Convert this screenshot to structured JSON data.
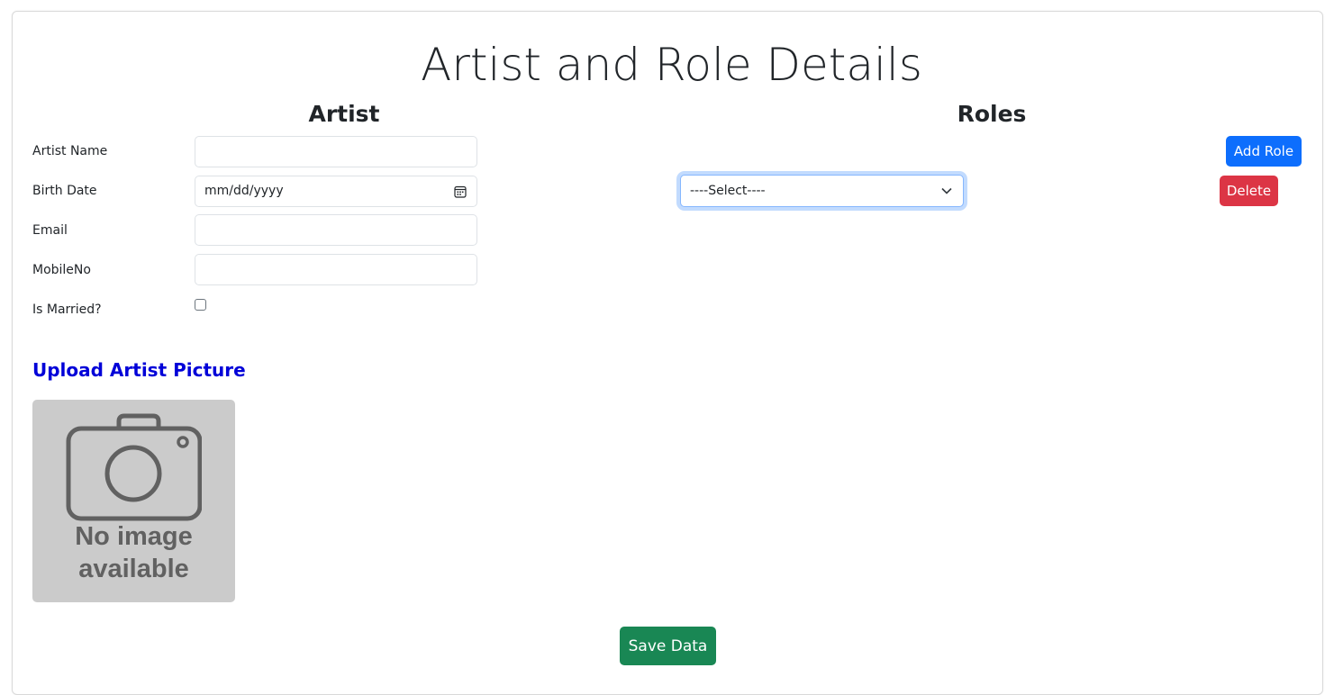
{
  "page": {
    "title": "Artist and Role Details"
  },
  "artist": {
    "heading": "Artist",
    "fields": {
      "name_label": "Artist Name",
      "name_value": "",
      "birth_date_label": "Birth Date",
      "birth_date_placeholder": "mm/dd/yyyy",
      "email_label": "Email",
      "email_value": "",
      "mobile_label": "MobileNo",
      "mobile_value": "",
      "married_label": "Is Married?",
      "married_checked": false
    },
    "upload": {
      "heading": "Upload Artist Picture",
      "placeholder_line1": "No image",
      "placeholder_line2": "available"
    }
  },
  "roles": {
    "heading": "Roles",
    "add_button_label": "Add Role",
    "rows": [
      {
        "selected": "----Select----",
        "delete_label": "Delete"
      }
    ]
  },
  "actions": {
    "save_label": "Save Data"
  },
  "colors": {
    "primary": "#0d6efd",
    "danger": "#dc3545",
    "success": "#198754",
    "upload_heading": "#0000d8",
    "placeholder_bg": "#cbcbcb",
    "placeholder_fg": "#616161"
  },
  "icons": {
    "date_input": "calendar-icon",
    "role_select": "chevron-down-icon",
    "picture": "camera-icon"
  }
}
